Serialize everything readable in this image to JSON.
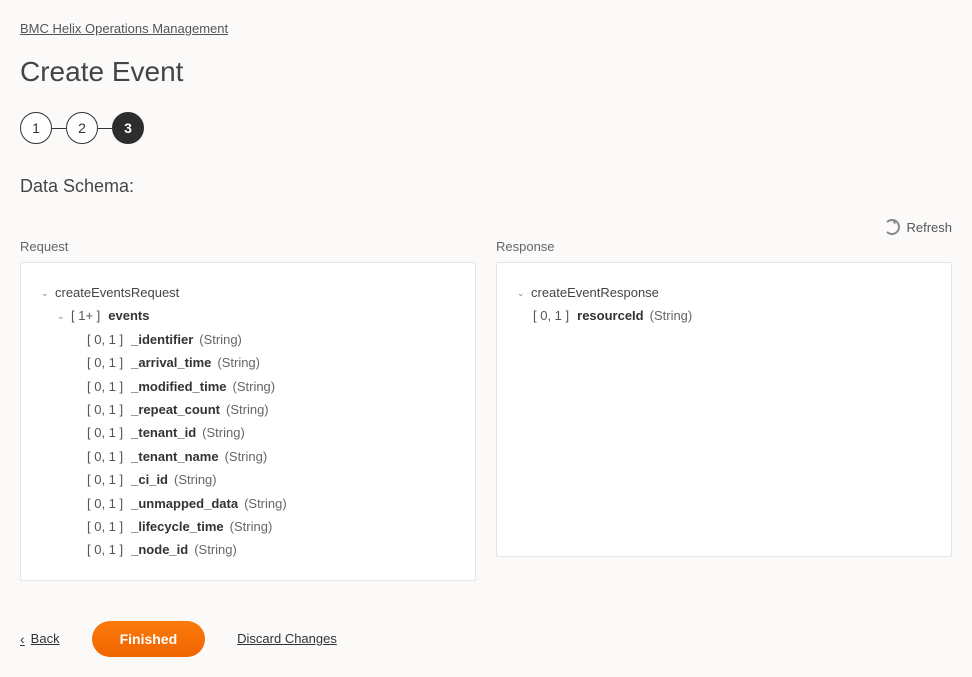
{
  "breadcrumb": {
    "label": "BMC Helix Operations Management"
  },
  "page": {
    "title": "Create Event",
    "section_title": "Data Schema:"
  },
  "stepper": {
    "steps": [
      "1",
      "2",
      "3"
    ],
    "active_index": 2
  },
  "refresh": {
    "label": "Refresh"
  },
  "panels": {
    "request_label": "Request",
    "response_label": "Response"
  },
  "request_schema": {
    "root": "createEventsRequest",
    "events_cardinality": "[ 1+ ]",
    "events_name": "events",
    "fields": [
      {
        "cardinality": "[ 0, 1 ]",
        "name": "_identifier",
        "type": "(String)"
      },
      {
        "cardinality": "[ 0, 1 ]",
        "name": "_arrival_time",
        "type": "(String)"
      },
      {
        "cardinality": "[ 0, 1 ]",
        "name": "_modified_time",
        "type": "(String)"
      },
      {
        "cardinality": "[ 0, 1 ]",
        "name": "_repeat_count",
        "type": "(String)"
      },
      {
        "cardinality": "[ 0, 1 ]",
        "name": "_tenant_id",
        "type": "(String)"
      },
      {
        "cardinality": "[ 0, 1 ]",
        "name": "_tenant_name",
        "type": "(String)"
      },
      {
        "cardinality": "[ 0, 1 ]",
        "name": "_ci_id",
        "type": "(String)"
      },
      {
        "cardinality": "[ 0, 1 ]",
        "name": "_unmapped_data",
        "type": "(String)"
      },
      {
        "cardinality": "[ 0, 1 ]",
        "name": "_lifecycle_time",
        "type": "(String)"
      },
      {
        "cardinality": "[ 0, 1 ]",
        "name": "_node_id",
        "type": "(String)"
      }
    ]
  },
  "response_schema": {
    "root": "createEventResponse",
    "fields": [
      {
        "cardinality": "[ 0, 1 ]",
        "name": "resourceId",
        "type": "(String)"
      }
    ]
  },
  "actions": {
    "back": "Back",
    "finished": "Finished",
    "discard": "Discard Changes"
  }
}
